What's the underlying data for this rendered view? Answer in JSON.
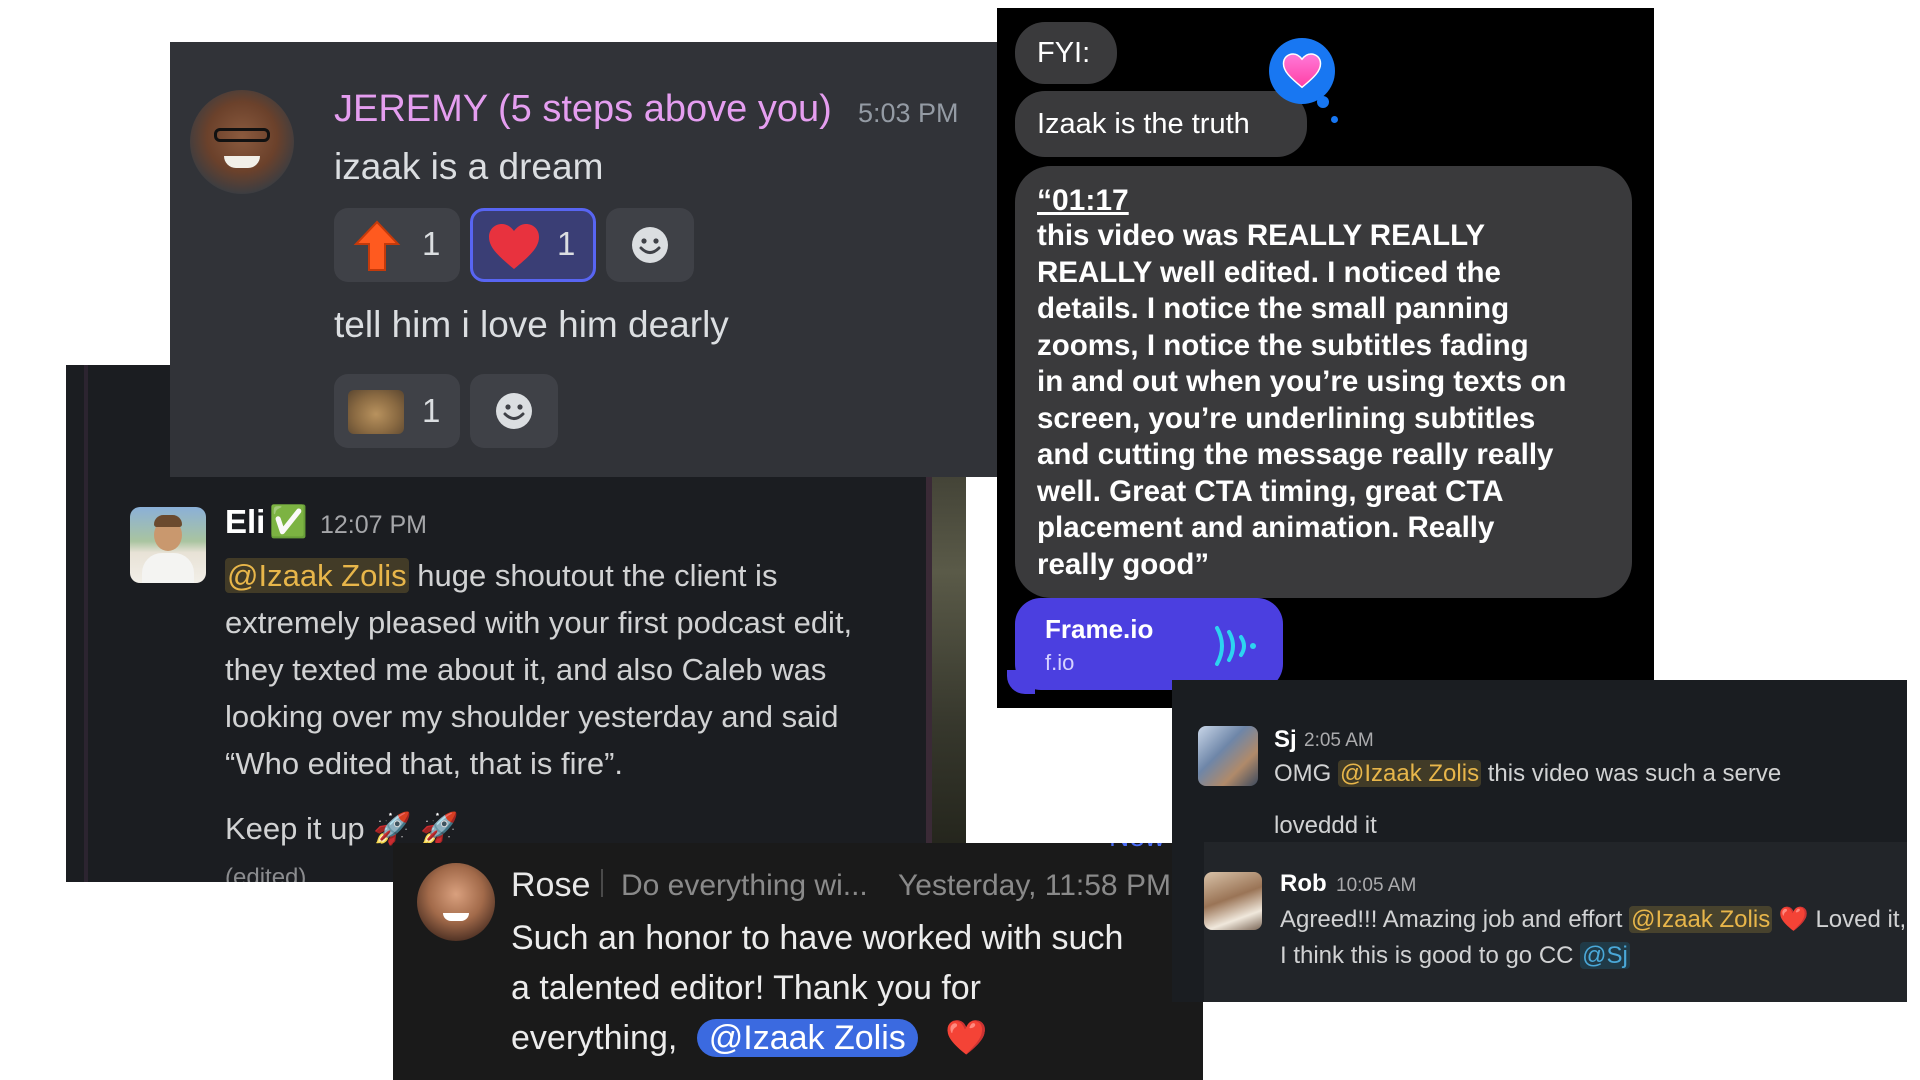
{
  "jeremy": {
    "name": "JEREMY (5 steps above you)",
    "time": "5:03 PM",
    "msg1": "izaak is a dream",
    "msg2": "tell him i love him dearly",
    "reactions1": [
      {
        "emoji": "up-arrow",
        "count": "1"
      },
      {
        "emoji": "heart",
        "count": "1"
      }
    ],
    "reactions2": [
      {
        "emoji": "cat-photo",
        "count": "1"
      }
    ]
  },
  "eli": {
    "name": "Eli",
    "verified": "✅",
    "time": "12:07 PM",
    "mention": "@Izaak Zolis",
    "line1": " huge shoutout the client is",
    "line2": "extremely pleased with your first podcast edit,",
    "line3": "they texted me about it, and also Caleb was",
    "line4": "looking over my shoulder yesterday and said",
    "line5": "“Who edited that, that is fire”.",
    "line6": "Keep it up 🚀 🚀",
    "edited": "(edited)"
  },
  "rose": {
    "name": "Rose",
    "status": "Do everything wi...",
    "time": "Yesterday, 11:58 PM",
    "line1": "Such an honor to have worked with such",
    "line2": "a talented editor! Thank you for",
    "line3": "everything,",
    "mention": "@Izaak Zolis",
    "heart": "❤️",
    "new_label": "New"
  },
  "imessage": {
    "bubble1": "FYI:",
    "bubble2": "Izaak is the truth",
    "quote_time": "“01:17",
    "quote_lines": [
      "this video was REALLY REALLY",
      "REALLY well edited. I noticed the",
      "details. I notice the small panning",
      "zooms, I notice the subtitles fading",
      "in and out when you’re using texts on",
      "screen, you’re underlining subtitles",
      "and cutting the message really really",
      "well. Great CTA timing, great CTA",
      "placement and animation. Really",
      "really good”"
    ],
    "link_title": "Frame.io",
    "link_domain": "f.io"
  },
  "slack2": {
    "sj_name": "Sj",
    "sj_time": "2:05 AM",
    "sj_pre": "OMG",
    "sj_mention": "@Izaak Zolis",
    "sj_post": "this video was such a serve",
    "sj_line2": "loveddd it",
    "rob_name": "Rob",
    "rob_time": "10:05 AM",
    "rob_pre": "Agreed!!! Amazing job and effort",
    "rob_mention": "@Izaak Zolis",
    "rob_heart": "❤️",
    "rob_post": "Loved it,",
    "rob_line2": "I think this is good to go CC",
    "rob_cc": "@Sj"
  }
}
